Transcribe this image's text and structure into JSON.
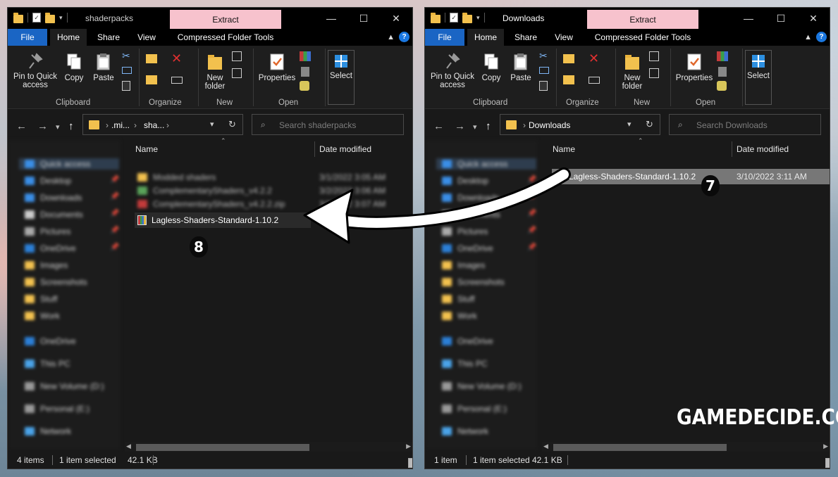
{
  "left_window": {
    "title": "shaderpacks",
    "contextual_tab": "Extract",
    "menu": [
      "File",
      "Home",
      "Share",
      "View",
      "Compressed Folder Tools"
    ],
    "ribbon": {
      "pin_label": "Pin to Quick access",
      "copy_label": "Copy",
      "paste_label": "Paste",
      "new_folder_label": "New folder",
      "properties_label": "Properties",
      "select_label": "Select",
      "groups": [
        "Clipboard",
        "Organize",
        "New",
        "Open"
      ]
    },
    "address": {
      "crumb1": ".mi...",
      "crumb2": "sha..."
    },
    "search_placeholder": "Search shaderpacks",
    "columns": {
      "name": "Name",
      "date": "Date modified"
    },
    "blurred_files": [
      "Modded shaders",
      "ComplementaryShaders_v4.2.2",
      "ComplementaryShaders_v4.2.2.zip"
    ],
    "blurred_dates": [
      "3/1/2022 3:05 AM",
      "3/2/2022 3:06 AM",
      "3/3/2022 3:07 AM"
    ],
    "file": {
      "name": "Lagless-Shaders-Standard-1.10.2"
    },
    "step_badge": "8",
    "status": {
      "count": "4 items",
      "selection": "1 item selected",
      "size": "42.1 KB"
    },
    "nav_items": [
      "Quick access",
      "Desktop",
      "Downloads",
      "Documents",
      "Pictures",
      "OneDrive",
      "Images",
      "Screenshots",
      "Stuff",
      "Work",
      "OneDrive",
      "This PC",
      "New Volume (D:)",
      "Personal (E:)",
      "Network"
    ]
  },
  "right_window": {
    "title": "Downloads",
    "contextual_tab": "Extract",
    "menu": [
      "File",
      "Home",
      "Share",
      "View",
      "Compressed Folder Tools"
    ],
    "ribbon": {
      "pin_label": "Pin to Quick access",
      "copy_label": "Copy",
      "paste_label": "Paste",
      "new_folder_label": "New folder",
      "properties_label": "Properties",
      "select_label": "Select",
      "groups": [
        "Clipboard",
        "Organize",
        "New",
        "Open"
      ]
    },
    "address": {
      "crumb1": "Downloads"
    },
    "search_placeholder": "Search Downloads",
    "columns": {
      "name": "Name",
      "date": "Date modified"
    },
    "file": {
      "name": "Lagless-Shaders-Standard-1.10.2",
      "date": "3/10/2022 3:11 AM"
    },
    "step_badge": "7",
    "status": {
      "count": "1 item",
      "selection": "1 item selected",
      "size": "42.1 KB"
    },
    "nav_items": [
      "Quick access",
      "Desktop",
      "Downloads",
      "Documents",
      "Pictures",
      "OneDrive",
      "Images",
      "Screenshots",
      "Stuff",
      "Work",
      "OneDrive",
      "This PC",
      "New Volume (D:)",
      "Personal (E:)",
      "Network"
    ]
  },
  "watermark": "GAMEDECIDE.COM",
  "colors": {
    "file_tab": "#1a65c4",
    "extract_tab": "#f7c2cd",
    "selection": "#777777",
    "folder": "#f2c14e"
  }
}
